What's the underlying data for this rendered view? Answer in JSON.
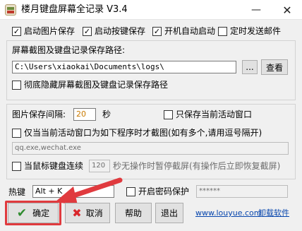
{
  "window": {
    "title": "楼月键盘屏幕全记录 V3.4",
    "minimize": "—",
    "close": "✕"
  },
  "options_top": {
    "save_images": "启动图片保存",
    "save_keys": "启动按键保存",
    "autostart": "开机自动启动",
    "email": "定时发送邮件"
  },
  "path_group": {
    "label": "屏幕截图及键盘记录保存路径:",
    "path_value": "C:\\Users\\xiaokai\\Documents\\logs\\",
    "dots_label": "...",
    "view_label": "查看",
    "hide_label": "彻底隐藏屏幕截图及键盘记录保存路径"
  },
  "interval_group": {
    "interval_label": "图片保存间隔:",
    "interval_value": "20",
    "unit": "秒",
    "active_window_label": "只保存当前活动窗口",
    "program_label": "仅当当前活动窗口为如下程序时才截图(如有多个,请用逗号隔开)",
    "program_value": "qq.exe,wechat.exe",
    "keyboard_cont_label": "当鼠标键盘连续",
    "keyboard_cont_value": "120",
    "pause_label": "秒无操作时暂停截屏(有操作后立即恢复截屏)"
  },
  "hotkey": {
    "label": "热键",
    "value": "Alt + K",
    "password_label": "开启密码保护",
    "password_value": "******"
  },
  "footer": {
    "ok": "确定",
    "cancel": "取消",
    "help": "帮助",
    "exit": "退出",
    "website": "www.louyue.com",
    "uninstall": "卸载软件"
  },
  "colors": {
    "accent": "#e03a3e",
    "link": "#0645ad",
    "check_green": "#2e8b2e",
    "cross_red": "#d9262b"
  }
}
